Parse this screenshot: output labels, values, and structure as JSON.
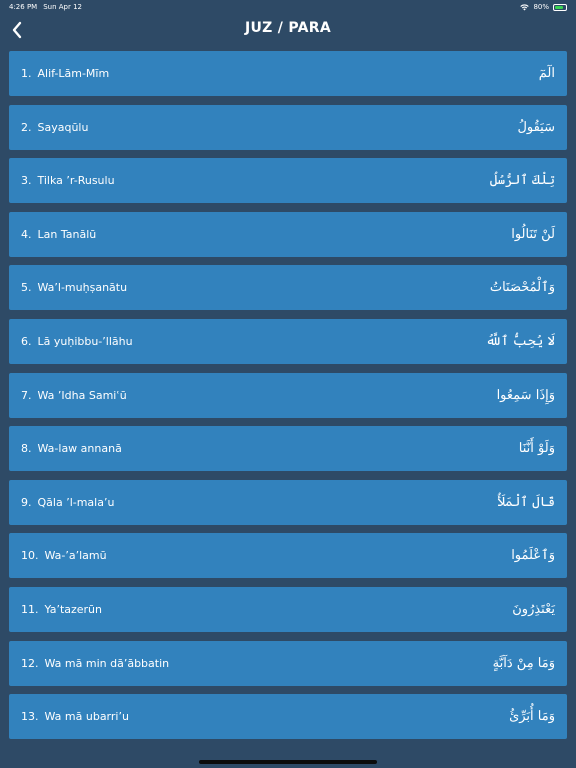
{
  "status_bar": {
    "time": "4:26 PM",
    "date": "Sun Apr 12",
    "battery_percent": "80%",
    "battery_level": 0.8
  },
  "nav": {
    "title": "JUZ / PARA",
    "back_icon": "chevron-left-icon"
  },
  "colors": {
    "background": "#2e4a66",
    "row": "#3282bd"
  },
  "juz_list": [
    {
      "num": "1.",
      "name": "Alif-Lām-Mīm",
      "arabic": "الٓمٓ"
    },
    {
      "num": "2.",
      "name": "Sayaqūlu",
      "arabic": "سَيَقُولُ"
    },
    {
      "num": "3.",
      "name": "Tilka ’r-Rusulu",
      "arabic": "تِلْكَ ٱلرُّسُلُ"
    },
    {
      "num": "4.",
      "name": "Lan Tanālū",
      "arabic": "لَنْ تَنَالُوا"
    },
    {
      "num": "5.",
      "name": "Wa’l-muḥṣanātu",
      "arabic": "وَٱلْمُحْصَنَاتُ"
    },
    {
      "num": "6.",
      "name": "Lā yuḥibbu-’llāhu",
      "arabic": "لَا يُحِبُّ ٱللَّهُ"
    },
    {
      "num": "7.",
      "name": "Wa ’Idha Samiʿū",
      "arabic": "وَإِذَا سَمِعُوا"
    },
    {
      "num": "8.",
      "name": "Wa-law annanā",
      "arabic": "وَلَوْ أَنَّنَا"
    },
    {
      "num": "9.",
      "name": "Qāla ’l-mala’u",
      "arabic": "قَالَ ٱلْمَلَأُ"
    },
    {
      "num": "10.",
      "name": "Wa-’a’lamū",
      "arabic": "وَٱعْلَمُوا"
    },
    {
      "num": "11.",
      "name": "Ya’tazerūn",
      "arabic": "يَعْتَذِرُونَ"
    },
    {
      "num": "12.",
      "name": "Wa mā min dā’ābbatin",
      "arabic": "وَمَا مِنْ دَآبَّةٍ"
    },
    {
      "num": "13.",
      "name": "Wa mā ubarri’u",
      "arabic": "وَمَا أُبَرِّئُ"
    }
  ]
}
